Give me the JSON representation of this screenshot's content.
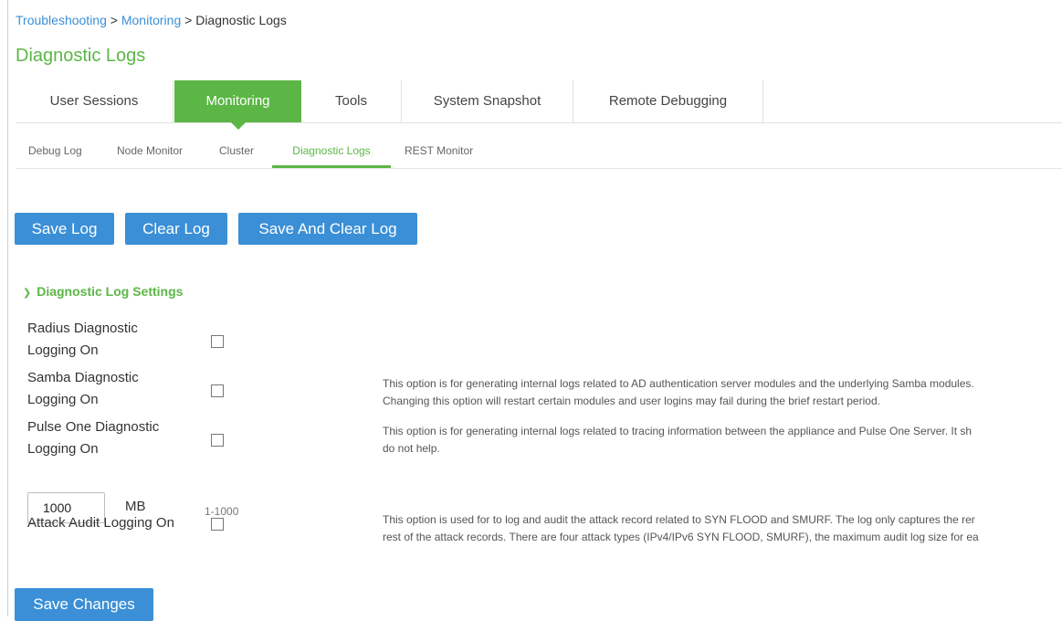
{
  "breadcrumb": {
    "link1": "Troubleshooting",
    "sep1": " > ",
    "link2": "Monitoring",
    "sep2": " > ",
    "current": "Diagnostic Logs"
  },
  "page_title": "Diagnostic Logs",
  "main_tabs": [
    {
      "label": "User Sessions",
      "active": false
    },
    {
      "label": "Monitoring",
      "active": true
    },
    {
      "label": "Tools",
      "active": false
    },
    {
      "label": "System Snapshot",
      "active": false
    },
    {
      "label": "Remote Debugging",
      "active": false
    }
  ],
  "sub_tabs": [
    {
      "label": "Debug Log",
      "active": false
    },
    {
      "label": "Node Monitor",
      "active": false
    },
    {
      "label": "Cluster",
      "active": false
    },
    {
      "label": "Diagnostic Logs",
      "active": true
    },
    {
      "label": "REST Monitor",
      "active": false
    }
  ],
  "buttons": {
    "save_log": "Save Log",
    "clear_log": "Clear Log",
    "save_and_clear_log": "Save And Clear Log",
    "save_changes": "Save Changes"
  },
  "section": {
    "title": "Diagnostic Log Settings",
    "chevron_icon": "chevron-down-icon"
  },
  "settings": {
    "radius": {
      "label_line1": "Radius Diagnostic",
      "label_line2": "Logging On",
      "checked": false
    },
    "samba": {
      "label_line1": "Samba Diagnostic",
      "label_line2": "Logging On",
      "checked": false,
      "help_line1": "This option is for generating internal logs related to AD authentication server modules and the underlying Samba modules.",
      "help_line2": "Changing this option will restart certain modules and user logins may fail during the brief restart period."
    },
    "pulse_one": {
      "label_line1": "Pulse One Diagnostic",
      "label_line2": "Logging On",
      "checked": false,
      "help_line1": "This option is for generating internal logs related to tracing information between the appliance and Pulse One Server. It sh",
      "help_line2": "do not help."
    },
    "log_size": {
      "value": "1000",
      "unit": "MB",
      "range": "1-1000"
    },
    "attack_audit": {
      "label": "Attack Audit Logging On",
      "checked": false,
      "help_line1": "This option is used for to log and audit the attack record related to SYN FLOOD and SMURF. The log only captures the rer",
      "help_line2": "rest of the attack records. There are four attack types (IPv4/IPv6 SYN FLOOD, SMURF), the maximum audit log size for ea"
    }
  },
  "colors": {
    "accent_green": "#5cb646",
    "button_blue": "#3b8fd6",
    "link_blue": "#3b8fd6"
  }
}
